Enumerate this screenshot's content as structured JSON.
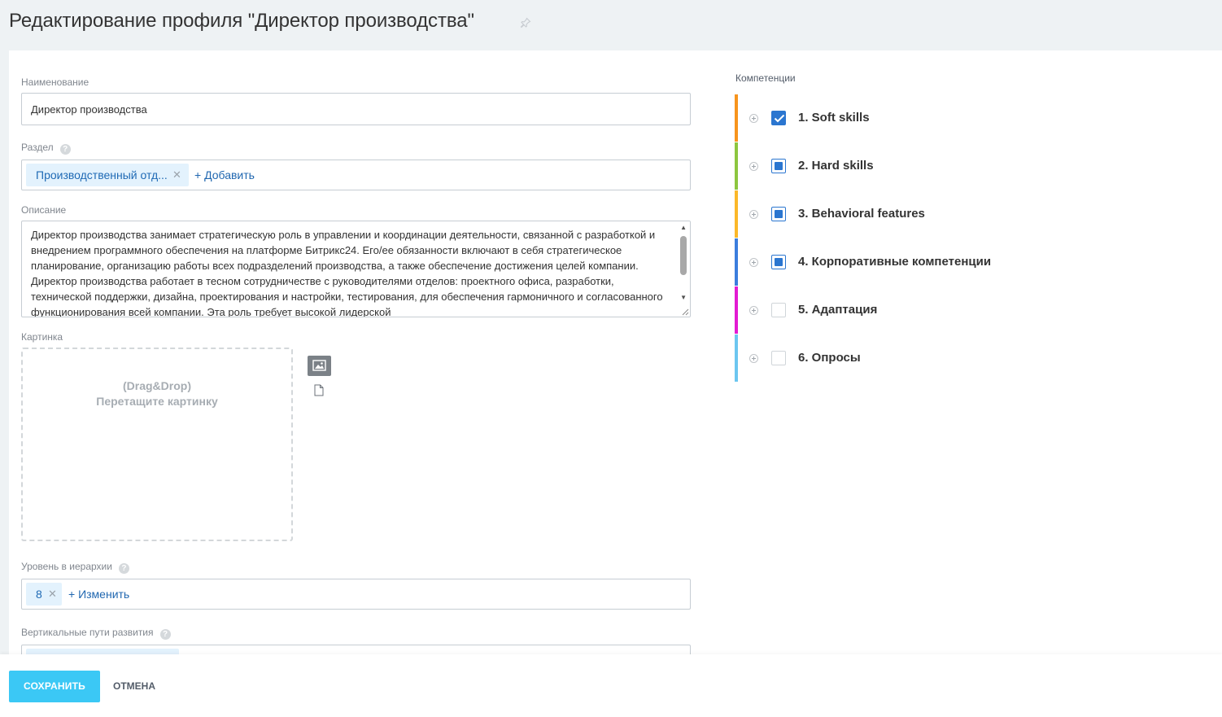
{
  "header": {
    "title": "Редактирование профиля \"Директор производства\""
  },
  "form": {
    "name": {
      "label": "Наименование",
      "value": "Директор производства"
    },
    "section": {
      "label": "Раздел",
      "tag": "Производственный отд...",
      "add_label": "+ Добавить"
    },
    "description": {
      "label": "Описание",
      "value": "Директор производства занимает стратегическую роль в управлении и координации деятельности, связанной с разработкой и внедрением программного обеспечения на платформе Битрикс24. Его/ее обязанности включают в себя стратегическое планирование, организацию работы всех подразделений производства, а также обеспечение достижения целей компании. Директор производства работает в тесном сотрудничестве с руководителями отделов: проектного офиса, разработки, технической поддержки, дизайна, проектирования и настройки, тестирования, для обеспечения гармоничного и согласованного функционирования всей компании. Эта роль требует высокой лидерской"
    },
    "picture": {
      "label": "Картинка",
      "hint_line1": "(Drag&Drop)",
      "hint_line2": "Перетащите картинку"
    },
    "hierarchy": {
      "label": "Уровень в иерархии",
      "tag": "8",
      "change_label": "+ Изменить"
    },
    "vertical_paths": {
      "label": "Вертикальные пути развития"
    }
  },
  "competencies": {
    "title": "Компетенции",
    "items": [
      {
        "label": "1. Soft skills",
        "state": "checked",
        "color": "#f7941d"
      },
      {
        "label": "2. Hard skills",
        "state": "partial",
        "color": "#8dc63f"
      },
      {
        "label": "3. Behavioral features",
        "state": "partial",
        "color": "#fbb829"
      },
      {
        "label": "4. Корпоративные компетенции",
        "state": "partial",
        "color": "#3b7ddd"
      },
      {
        "label": "5. Адаптация",
        "state": "unchecked",
        "color": "#e31bd2"
      },
      {
        "label": "6. Опросы",
        "state": "unchecked",
        "color": "#6cc6f0"
      }
    ]
  },
  "footer": {
    "save_label": "СОХРАНИТЬ",
    "cancel_label": "ОТМЕНА"
  }
}
